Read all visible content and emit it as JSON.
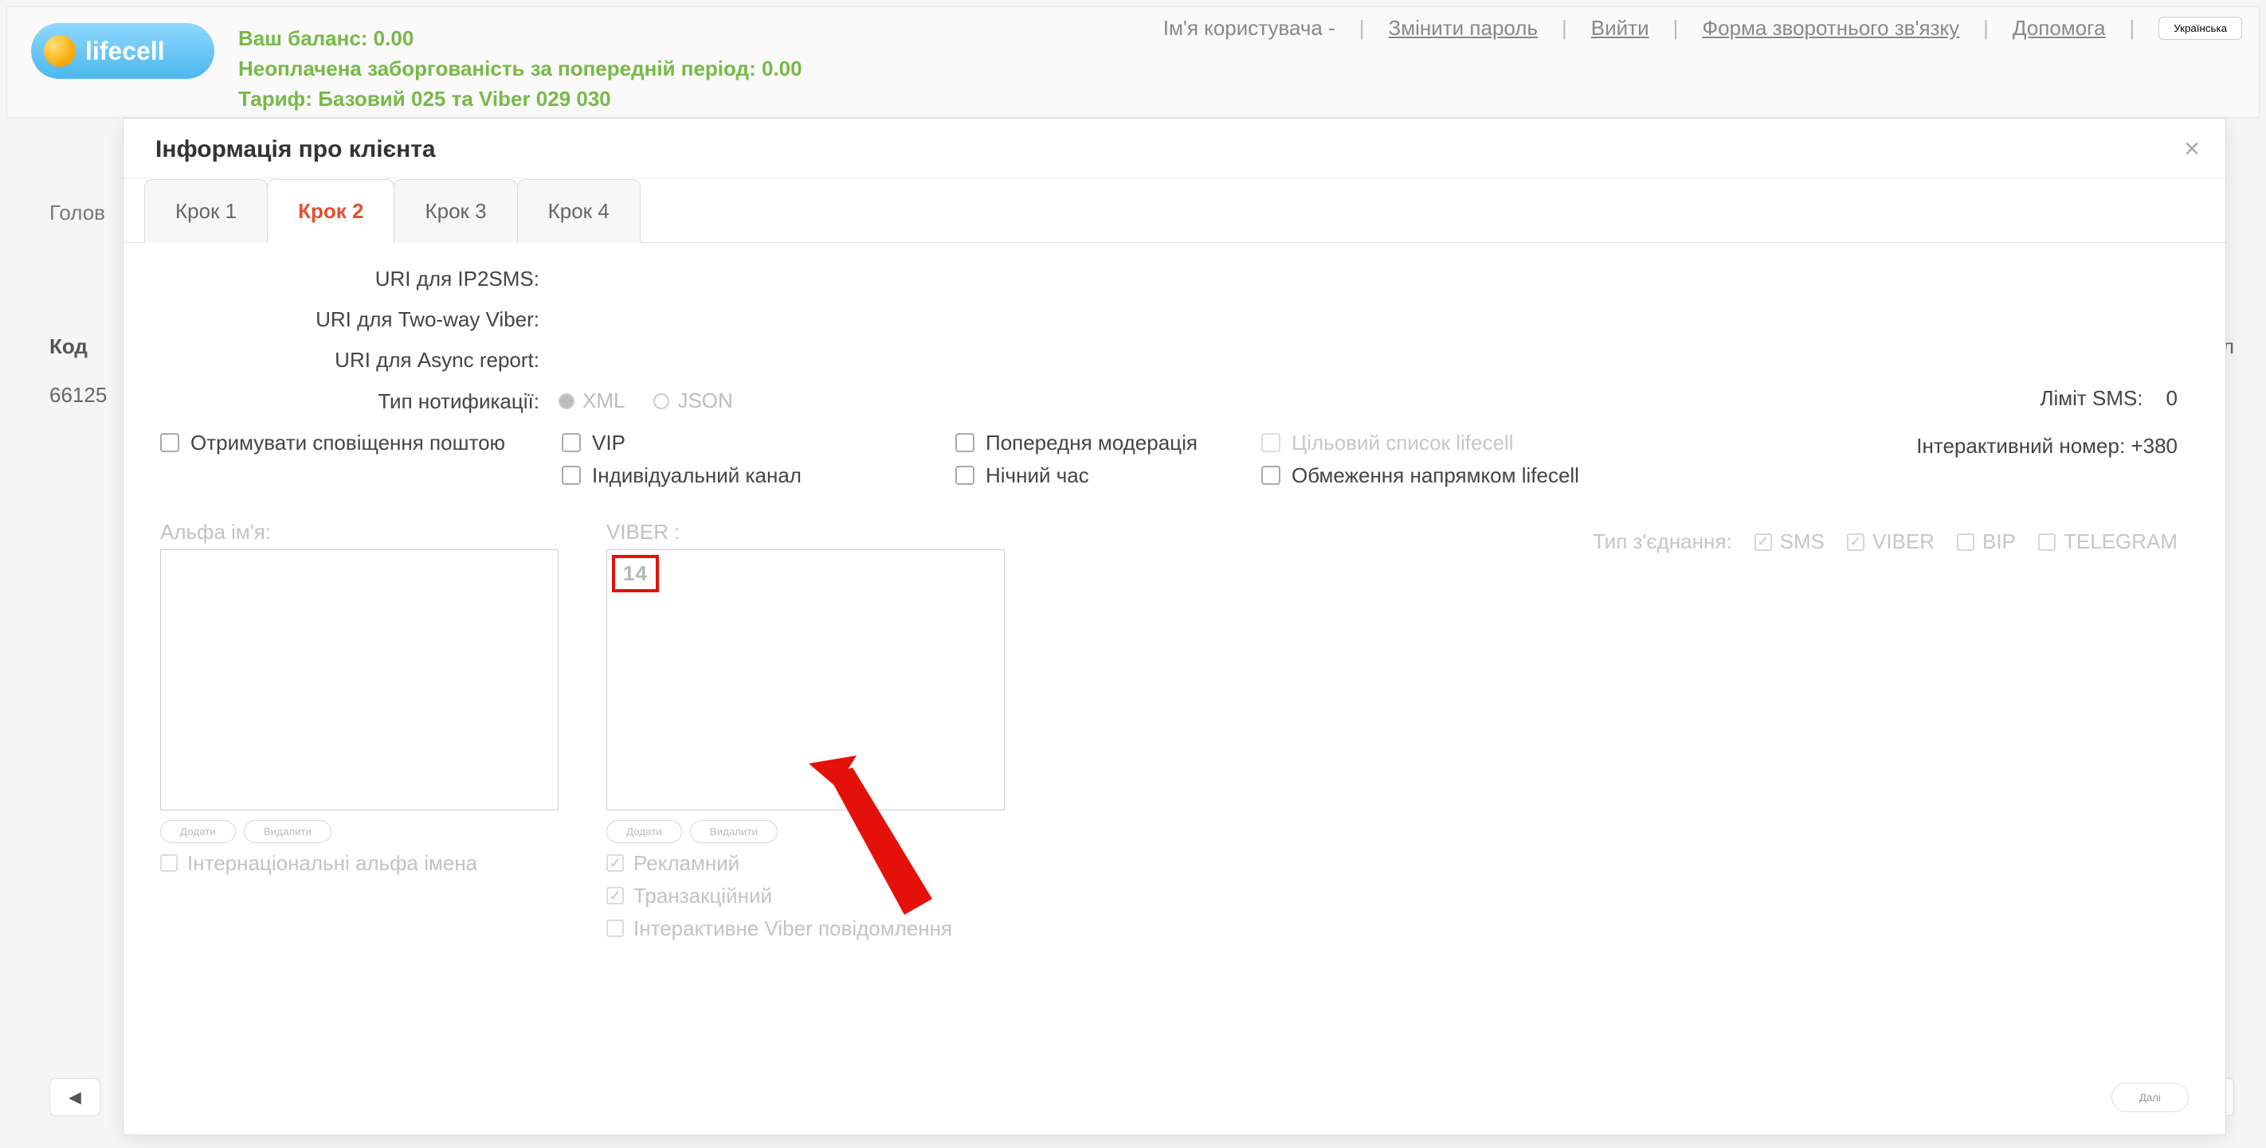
{
  "header": {
    "balance_label": "Ваш баланс: 0.00",
    "debt_label": "Неоплачена заборгованість за попередній період: 0.00",
    "tariff_label": "Тариф: Базовий 025 та Viber 029 030",
    "username_label": "Ім'я користувача -",
    "links": {
      "change_password": "Змінити пароль",
      "logout": "Вийти",
      "feedback": "Форма зворотнього зв'язку",
      "help": "Допомога"
    },
    "lang_button": "Українська",
    "logo_text": "lifecell"
  },
  "background": {
    "main_tab": "Голов",
    "col_kod": "Код",
    "cell_val": "66125",
    "col_right": "з біл"
  },
  "dialog": {
    "title": "Інформація про клієнта",
    "tabs": [
      "Крок 1",
      "Крок 2",
      "Крок 3",
      "Крок 4"
    ],
    "active_tab_index": 1,
    "labels": {
      "uri_ip2sms": "URI для IP2SMS:",
      "uri_twoway": "URI для Two-way Viber:",
      "uri_async": "URI для Async report:",
      "notif_type": "Тип нотификації:",
      "sms_limit": "Ліміт SMS:",
      "sms_limit_val": "0",
      "interactive_num": "Інтерактивний номер: +380",
      "conn_type": "Тип з'єднання:"
    },
    "notif_options": [
      "XML",
      "JSON"
    ],
    "conn_options": [
      "SMS",
      "VIBER",
      "BIP",
      "TELEGRAM"
    ],
    "conn_checked": {
      "SMS": true,
      "VIBER": true,
      "BIP": false,
      "TELEGRAM": false
    },
    "checks": {
      "email_notify": "Отримувати сповіщення поштою",
      "vip": "VIP",
      "indiv_channel": "Індивідуальний канал",
      "pre_moderation": "Попередня модерація",
      "night_time": "Нічний час",
      "lifecell_list": "Цільовий список lifecell",
      "lifecell_direction_limit": "Обмеження напрямком lifecell"
    },
    "lists": {
      "alpha_label": "Альфа ім'я:",
      "viber_label": "VIBER :",
      "viber_item": "14",
      "add_btn": "Додати",
      "del_btn": "Видалити",
      "intl_alpha": "Інтернаціональні альфа імена",
      "adv": "Рекламний",
      "trans": "Транзакційний",
      "interactive_viber": "Інтерактивне Viber повідомлення"
    },
    "next_button": "Далі"
  }
}
